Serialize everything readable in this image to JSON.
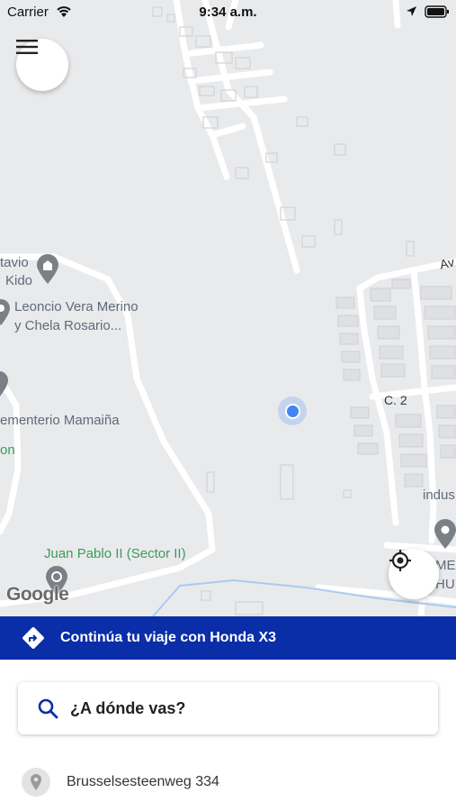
{
  "status_bar": {
    "carrier": "Carrier",
    "time": "9:34 a.m."
  },
  "map": {
    "labels": {
      "tavio": "tavio",
      "kido": "Kido",
      "leoncio_line1": "Leoncio Vera Merino",
      "leoncio_line2": "y Chela Rosario...",
      "cementerio": "ementerio Mamaiña",
      "on": "on",
      "juan_pablo": "Juan Pablo II (Sector II)",
      "c2": "C. 2",
      "av": "Av",
      "indus": "indus",
      "me": "ME",
      "hu": "HU"
    },
    "attribution": "Google",
    "icons": {
      "menu": "menu-icon",
      "locate": "my-location-icon",
      "user_location": "user-location-dot"
    }
  },
  "banner": {
    "icon": "directions-icon",
    "text": "Continúa tu viaje con Honda X3",
    "color": "#0a2da8"
  },
  "search": {
    "icon": "search-icon",
    "placeholder": "¿A dónde vas?",
    "icon_color": "#0a2da8"
  },
  "recent_places": [
    {
      "icon": "place-pin-icon",
      "label": "Brusselsesteenweg 334"
    }
  ]
}
